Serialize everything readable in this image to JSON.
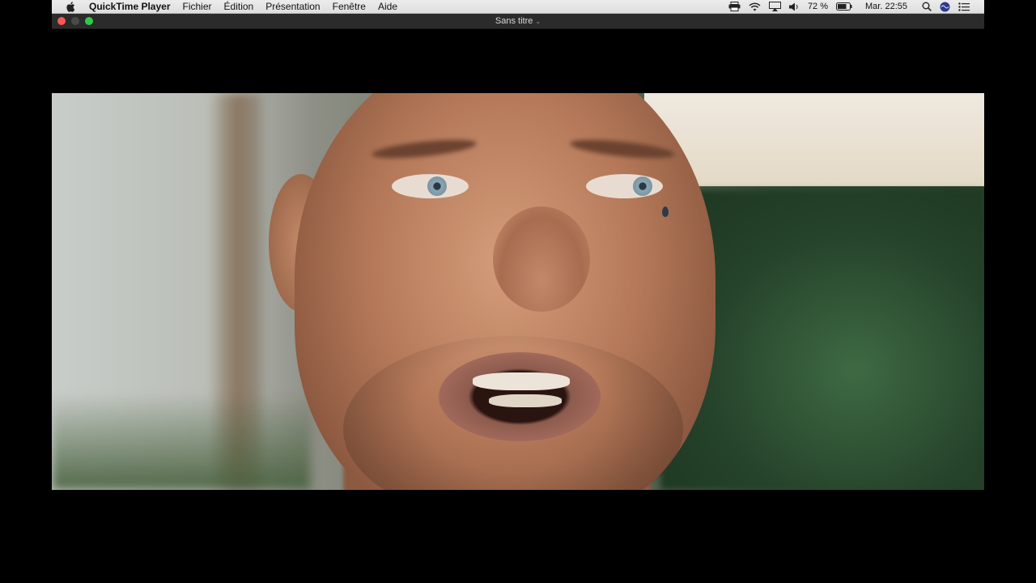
{
  "menubar": {
    "app_name": "QuickTime Player",
    "items": [
      "Fichier",
      "Édition",
      "Présentation",
      "Fenêtre",
      "Aide"
    ],
    "battery": "72 %",
    "clock": "Mar. 22:55",
    "status_icons": [
      "printer-icon",
      "wifi-icon",
      "airplay-icon",
      "volume-icon",
      "battery-icon",
      "search-icon",
      "siri-icon",
      "notification-center-icon"
    ]
  },
  "window": {
    "title": "Sans titre"
  },
  "video": {
    "description_icon": "video-frame"
  }
}
